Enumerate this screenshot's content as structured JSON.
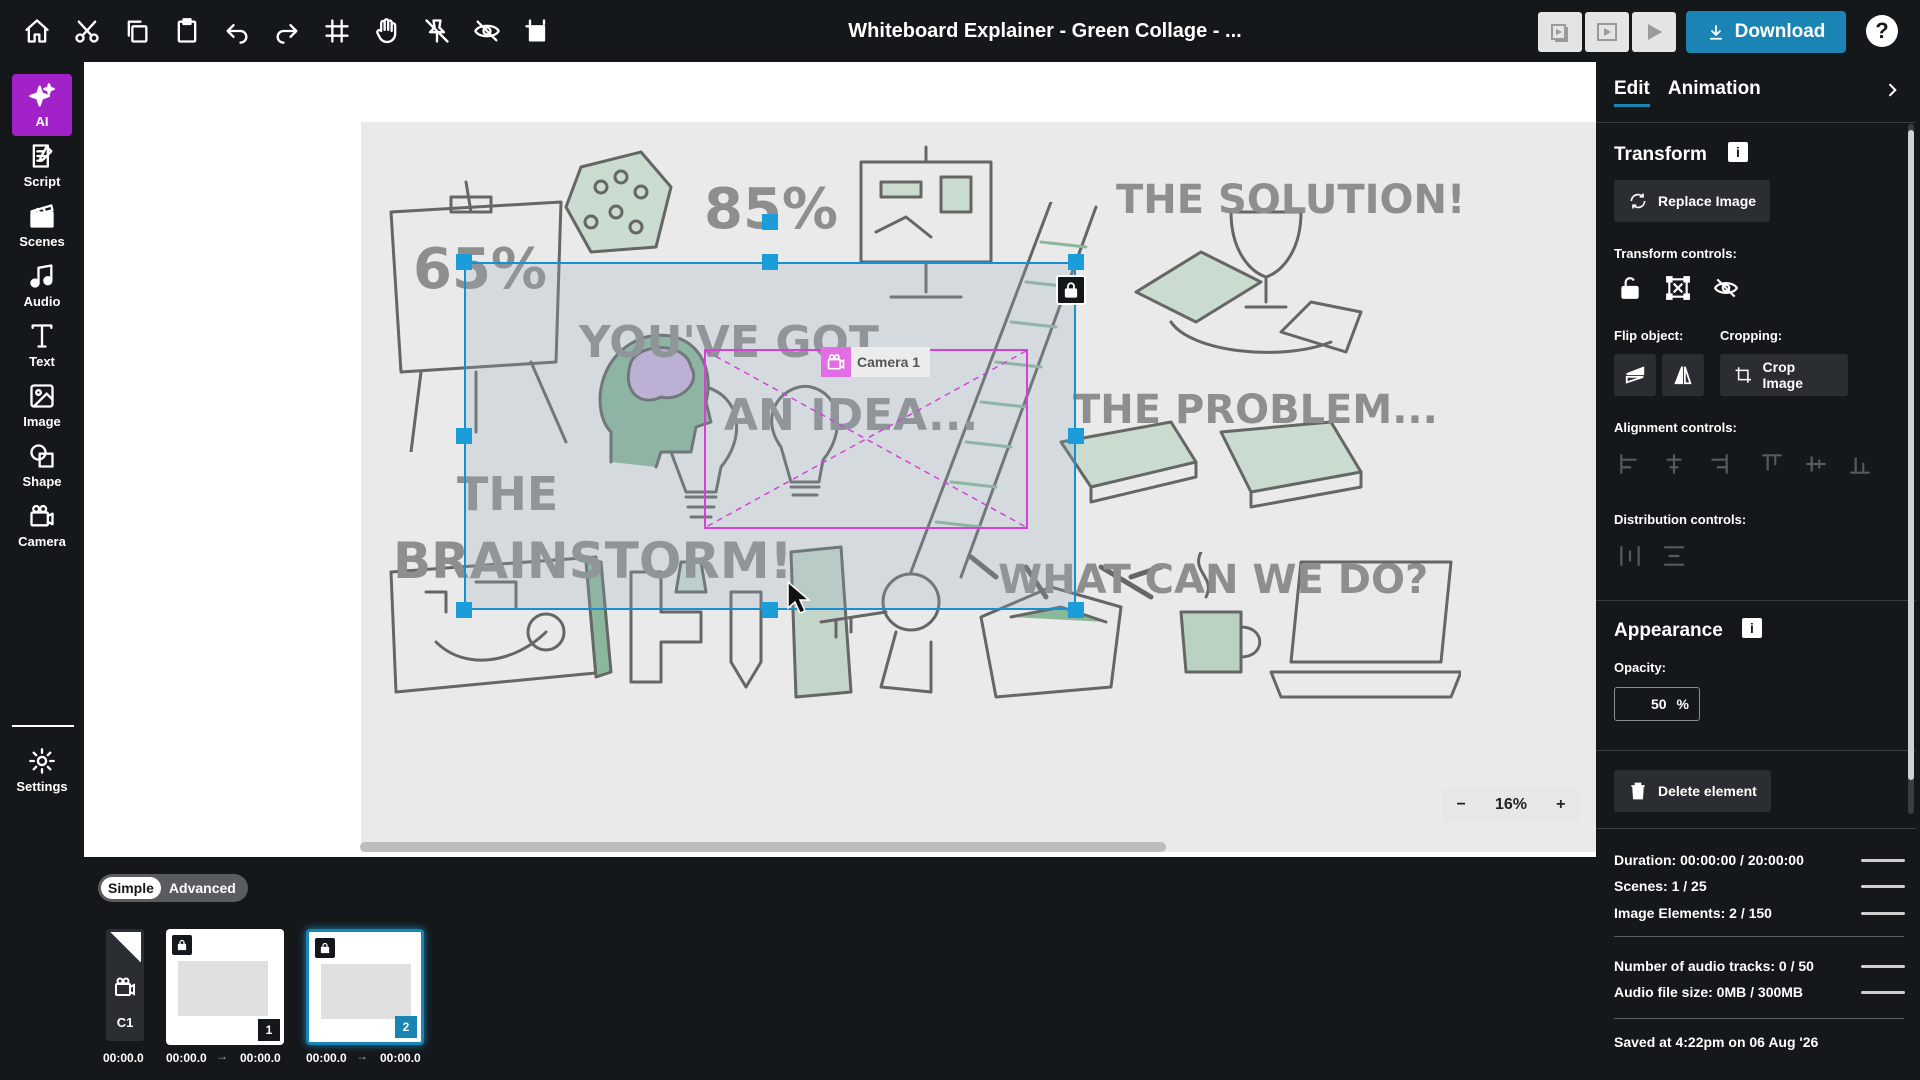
{
  "window": {
    "title": "Whiteboard Explainer - Green Collage - ..."
  },
  "toolbar": {
    "icons": [
      "home-icon",
      "cut-icon",
      "copy-icon",
      "paste-icon",
      "undo-icon",
      "redo-icon",
      "grid-icon",
      "hand-icon",
      "unpin-icon",
      "hide-icon",
      "crop-canvas-icon"
    ],
    "download_label": "Download",
    "help_label": "?"
  },
  "sidebar": {
    "items": [
      {
        "label": "AI",
        "icon": "sparkle-icon"
      },
      {
        "label": "Script",
        "icon": "script-icon"
      },
      {
        "label": "Scenes",
        "icon": "scenes-icon"
      },
      {
        "label": "Audio",
        "icon": "music-icon"
      },
      {
        "label": "Text",
        "icon": "text-icon"
      },
      {
        "label": "Image",
        "icon": "image-icon"
      },
      {
        "label": "Shape",
        "icon": "shape-icon"
      },
      {
        "label": "Camera",
        "icon": "camera-icon"
      },
      {
        "label": "Settings",
        "icon": "gear-icon"
      }
    ]
  },
  "canvas": {
    "texts": {
      "pct65": "65%",
      "pct85": "85%",
      "youve_got": "YOU'VE GOT",
      "an_idea": "AN IDEA...",
      "the": "THE",
      "brainstorm": "BRAINSTORM!",
      "solution": "THE SOLUTION!",
      "problem": "THE PROBLEM...",
      "what_can": "WHAT CAN WE DO?"
    },
    "camera_label": "Camera 1",
    "zoom": {
      "minus": "−",
      "value": "16%",
      "plus": "+"
    },
    "accent": "#1a9dd9",
    "camera_color": "#d540d9"
  },
  "panel": {
    "tabs": [
      "Edit",
      "Animation"
    ],
    "transform": {
      "title": "Transform",
      "replace_image": "Replace Image",
      "controls_label": "Transform controls:",
      "flip_label": "Flip object:",
      "cropping_label": "Cropping:",
      "crop_image": "Crop Image",
      "alignment_label": "Alignment controls:",
      "distribution_label": "Distribution controls:"
    },
    "appearance": {
      "title": "Appearance",
      "opacity_label": "Opacity:",
      "opacity_value": "50",
      "opacity_unit": "%"
    },
    "delete_label": "Delete element"
  },
  "stats": {
    "duration": "Duration: 00:00:00 / 20:00:00",
    "scenes": "Scenes: 1 / 25",
    "image_elements": "Image Elements: 2 / 150",
    "audio_tracks": "Number of audio tracks: 0 / 50",
    "audio_size": "Audio file size: 0MB / 300MB",
    "saved": "Saved at 4:22pm on 06 Aug '26"
  },
  "timeline": {
    "mode_simple": "Simple",
    "mode_advanced": "Advanced",
    "camera_card": {
      "label": "C1",
      "time": "00:00.0"
    },
    "scenes": [
      {
        "number": "1",
        "start": "00:00.0",
        "arrow": "→",
        "end": "00:00.0"
      },
      {
        "number": "2",
        "start": "00:00.0",
        "arrow": "→",
        "end": "00:00.0"
      }
    ]
  }
}
